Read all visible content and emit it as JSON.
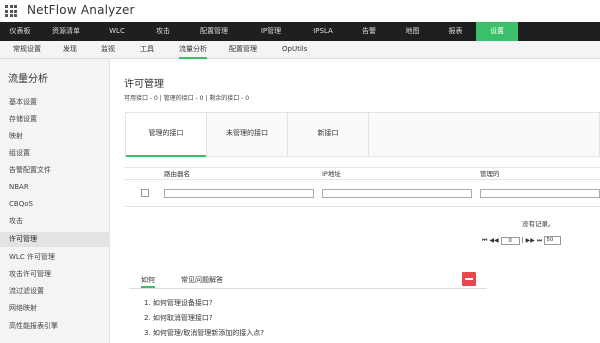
{
  "app": {
    "title": "NetFlow Analyzer"
  },
  "topnav": {
    "items": [
      {
        "label": "仪表板"
      },
      {
        "label": "资源清单"
      },
      {
        "label": "WLC"
      },
      {
        "label": "攻击"
      },
      {
        "label": "配置管理"
      },
      {
        "label": "IP管理"
      },
      {
        "label": "IPSLA"
      },
      {
        "label": "告警"
      },
      {
        "label": "地图"
      },
      {
        "label": "报表"
      },
      {
        "label": "设置"
      }
    ],
    "active_index": 10,
    "active_color": "#3bbf6b"
  },
  "subnav": {
    "items": [
      {
        "label": "常规设置"
      },
      {
        "label": "发现"
      },
      {
        "label": "监视"
      },
      {
        "label": "工具"
      },
      {
        "label": "流量分析"
      },
      {
        "label": "配置管理"
      },
      {
        "label": "OpUtils"
      }
    ],
    "active_index": 4
  },
  "sidebar": {
    "title": "流量分析",
    "items": [
      {
        "label": "基本设置"
      },
      {
        "label": "存储设置"
      },
      {
        "label": "映射"
      },
      {
        "label": "组设置"
      },
      {
        "label": "告警配置文件"
      },
      {
        "label": "NBAR"
      },
      {
        "label": "CBQoS"
      },
      {
        "label": "攻击"
      },
      {
        "label": "许可管理"
      },
      {
        "label": "WLC 许可管理"
      },
      {
        "label": "攻击许可管理"
      },
      {
        "label": "流过滤设置"
      },
      {
        "label": "网络映射"
      },
      {
        "label": "高性能报表引擎"
      }
    ],
    "active_index": 8
  },
  "main": {
    "title": "许可管理",
    "summary": "可用接口 - 0 | 管理的接口 - 0 | 剩余的接口 - 0",
    "tabs": [
      {
        "label": "管理的接口"
      },
      {
        "label": "未管理的接口"
      },
      {
        "label": "新接口"
      }
    ],
    "active_tab": 0,
    "table": {
      "columns": [
        {
          "label": "路由器名"
        },
        {
          "label": "IP地址"
        },
        {
          "label": "管理的"
        }
      ],
      "empty_text": "没有记录。",
      "pager": {
        "first": "⏮",
        "prev": "◀◀",
        "page_value": "0",
        "separator": "|",
        "next": "▶▶",
        "last": "⏭",
        "page_size": "50"
      }
    }
  },
  "help": {
    "tabs": [
      {
        "label": "如何"
      },
      {
        "label": "常见问题解答"
      }
    ],
    "active_tab": 0,
    "collapse_color": "#e8484d",
    "items": [
      {
        "label": "1. 如何管理设备接口?"
      },
      {
        "label": "2. 如何取消管理接口?"
      },
      {
        "label": "3. 如何管理/取消管理新添加的接入点?"
      }
    ]
  }
}
